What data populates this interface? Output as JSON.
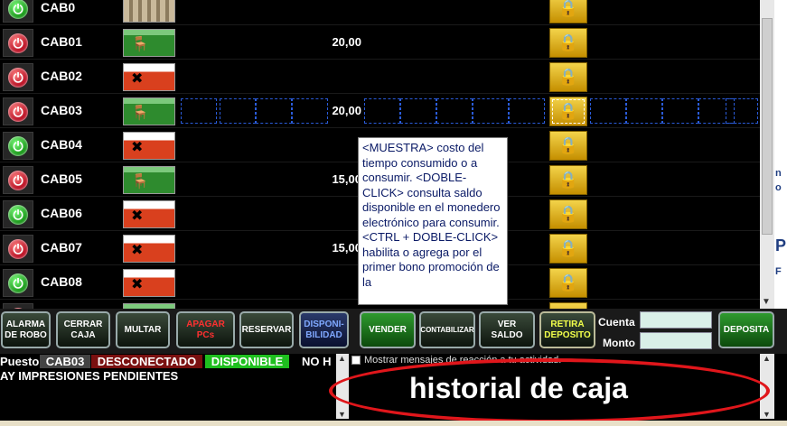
{
  "rows": [
    {
      "name": "CAB0",
      "power": "on",
      "status": "empty",
      "amount": ""
    },
    {
      "name": "CAB01",
      "power": "off",
      "status": "occupied",
      "amount": "20,00"
    },
    {
      "name": "CAB02",
      "power": "off",
      "status": "repair",
      "amount": ""
    },
    {
      "name": "CAB03",
      "power": "off",
      "status": "occupied",
      "amount": "20,00",
      "selected": true
    },
    {
      "name": "CAB04",
      "power": "on",
      "status": "repair",
      "amount": ""
    },
    {
      "name": "CAB05",
      "power": "off",
      "status": "occupied",
      "amount": "15,00"
    },
    {
      "name": "CAB06",
      "power": "on",
      "status": "repair",
      "amount": ""
    },
    {
      "name": "CAB07",
      "power": "off",
      "status": "repair",
      "amount": "15,00"
    },
    {
      "name": "CAB08",
      "power": "on",
      "status": "repair",
      "amount": ""
    },
    {
      "name": "",
      "power": "off",
      "status": "occupied",
      "amount": ""
    }
  ],
  "tooltip": "<MUESTRA> costo del tiempo consumido o a consumir. <DOBLE-CLICK> consulta saldo disponible en el monedero electrónico para consumir. <CTRL + DOBLE-CLICK> habilita o agrega por el primer bono promoción de la",
  "toolbar": {
    "alarma": "ALARMA DE ROBO",
    "cerrar": "CERRAR CAJA",
    "multar": "MULTAR",
    "apagar": "APAGAR PCs",
    "reservar": "RESERVAR",
    "disponibilidad": "DISPONI-BILIDAD",
    "vender": "VENDER",
    "contabilizar": "CONTABILIZAR",
    "ver_saldo": "VER SALDO",
    "retira": "RETIRA DEPOSITO",
    "cuenta_label": "Cuenta",
    "monto_label": "Monto",
    "deposita": "DEPOSITA"
  },
  "status": {
    "puesto_label": "Puesto:",
    "cab": "CAB03",
    "conn": "DESCONECTADO",
    "avail": "DISPONIBLE",
    "noh": "NO H",
    "impresiones": "AY IMPRESIONES PENDIENTES"
  },
  "messages": {
    "checkbox_label": "Mostrar mensajes de reacción a tu actividad.",
    "caption": "historial de caja"
  },
  "right_panel": [
    "n",
    "o",
    "P",
    "F"
  ],
  "colors": {
    "highlight": "#e0161b",
    "power_on": "#0a8a0a",
    "power_off": "#b00016"
  }
}
